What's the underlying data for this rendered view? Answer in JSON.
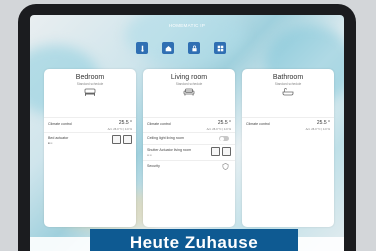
{
  "app": {
    "title": "HOMEMATIC IP"
  },
  "toolbar": {
    "icons": [
      "thermometer-icon",
      "home-icon",
      "lock-icon",
      "grid-icon"
    ]
  },
  "rooms": [
    {
      "name": "Bedroom",
      "subtitle": "Standard schedule",
      "icon": "bed-icon",
      "climate": {
        "label": "Climate control",
        "temp": "25.5 °",
        "sub": "Act. 26.0 °C | 4.0 %"
      },
      "device": {
        "label": "Bed actuator",
        "sub": "■ ▪▪"
      }
    },
    {
      "name": "Living room",
      "subtitle": "Standard schedule",
      "icon": "sofa-icon",
      "climate": {
        "label": "Climate control",
        "temp": "25.5 °",
        "sub": "Act. 26.0 °C | 4.0 %"
      },
      "ceiling": {
        "label": "Ceiling light living room"
      },
      "shutter": {
        "label": "Shutter Actuator living room",
        "sub": "▪▪ ▪▪"
      },
      "security": {
        "label": "Security"
      }
    },
    {
      "name": "Bathroom",
      "subtitle": "Standard schedule",
      "icon": "bathtub-icon",
      "climate": {
        "label": "Climate control",
        "temp": "25.5 °",
        "sub": "Act. 26.0 °C | 4.0 %"
      }
    }
  ],
  "banner": {
    "text": "Heute Zuhause"
  }
}
